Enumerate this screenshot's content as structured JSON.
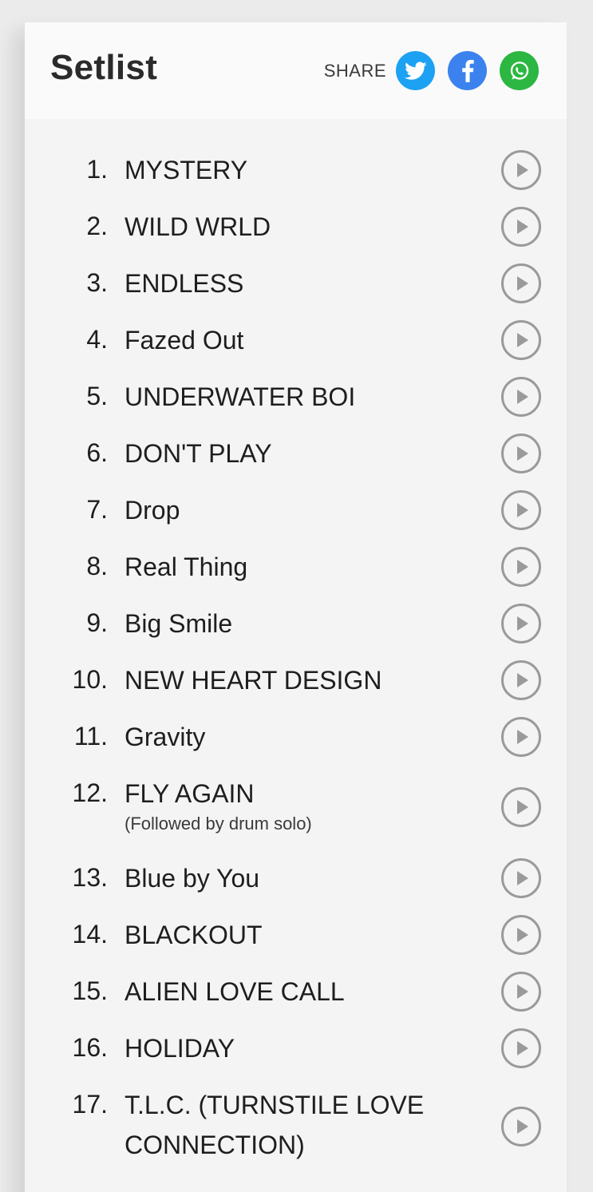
{
  "header": {
    "title": "Setlist",
    "share_label": "SHARE",
    "share_buttons": [
      {
        "network": "twitter",
        "icon": "twitter-bird-icon",
        "color": "#1da1f2"
      },
      {
        "network": "facebook",
        "icon": "facebook-f-icon",
        "color": "#3b82ee"
      },
      {
        "network": "whatsapp",
        "icon": "whatsapp-phone-icon",
        "color": "#2bb741"
      }
    ]
  },
  "setlist": [
    {
      "number": "1.",
      "title": "MYSTERY"
    },
    {
      "number": "2.",
      "title": "WILD WRLD"
    },
    {
      "number": "3.",
      "title": "ENDLESS"
    },
    {
      "number": "4.",
      "title": "Fazed Out"
    },
    {
      "number": "5.",
      "title": "UNDERWATER BOI"
    },
    {
      "number": "6.",
      "title": "DON'T PLAY"
    },
    {
      "number": "7.",
      "title": "Drop"
    },
    {
      "number": "8.",
      "title": "Real Thing"
    },
    {
      "number": "9.",
      "title": "Big Smile"
    },
    {
      "number": "10.",
      "title": "NEW HEART DESIGN"
    },
    {
      "number": "11.",
      "title": "Gravity"
    },
    {
      "number": "12.",
      "title": "FLY AGAIN",
      "note": "(Followed by drum solo)"
    },
    {
      "number": "13.",
      "title": "Blue by You"
    },
    {
      "number": "14.",
      "title": "BLACKOUT"
    },
    {
      "number": "15.",
      "title": "ALIEN LOVE CALL"
    },
    {
      "number": "16.",
      "title": "HOLIDAY"
    },
    {
      "number": "17.",
      "title_lines": [
        "T.L.C. (TURNSTILE LOVE",
        "CONNECTION)"
      ]
    }
  ],
  "colors": {
    "play_icon": "#9a9a9a",
    "text": "#1e1e1e"
  }
}
